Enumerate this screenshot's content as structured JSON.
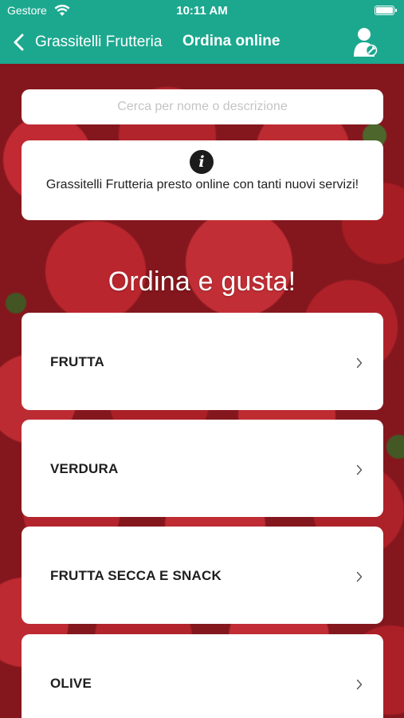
{
  "status_bar": {
    "carrier": "Gestore",
    "time": "10:11 AM"
  },
  "nav": {
    "back_label": "Grassitelli Frutteria",
    "title": "Ordina online"
  },
  "search": {
    "placeholder": "Cerca per nome o descrizione",
    "value": ""
  },
  "info": {
    "icon": "info-icon",
    "message": "Grassitelli Frutteria presto online con tanti nuovi servizi!"
  },
  "headline": "Ordina e gusta!",
  "categories": [
    {
      "label": "FRUTTA"
    },
    {
      "label": "VERDURA"
    },
    {
      "label": "FRUTTA SECCA E SNACK"
    },
    {
      "label": "OLIVE"
    }
  ],
  "colors": {
    "accent": "#1ca88f",
    "card": "#ffffff",
    "text": "#1e1e1e"
  }
}
